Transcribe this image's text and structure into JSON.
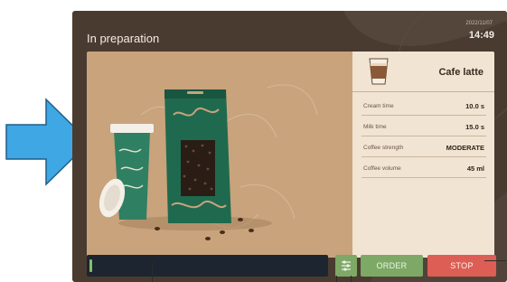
{
  "header": {
    "title": "In preparation",
    "date": "2022/11/07",
    "time": "14:49"
  },
  "drink": {
    "name": "Cafe latte",
    "icon": "latte-cup-icon",
    "details": [
      {
        "label": "Cream time",
        "value": "10.0 s"
      },
      {
        "label": "Milk time",
        "value": "15.0 s"
      },
      {
        "label": "Coffee strength",
        "value": "MODERATE"
      },
      {
        "label": "Coffee volume",
        "value": "45 ml"
      }
    ]
  },
  "progress": {
    "fraction": 0.01
  },
  "controls": {
    "settings_icon": "sliders-icon",
    "order_label": "ORDER",
    "stop_label": "STOP"
  },
  "colors": {
    "annotation_arrow": "#3fa7e3",
    "panel": "#4a3b31",
    "order_button": "#7ea866",
    "stop_button": "#dc5e55",
    "progress_fill": "#7ec26a"
  }
}
